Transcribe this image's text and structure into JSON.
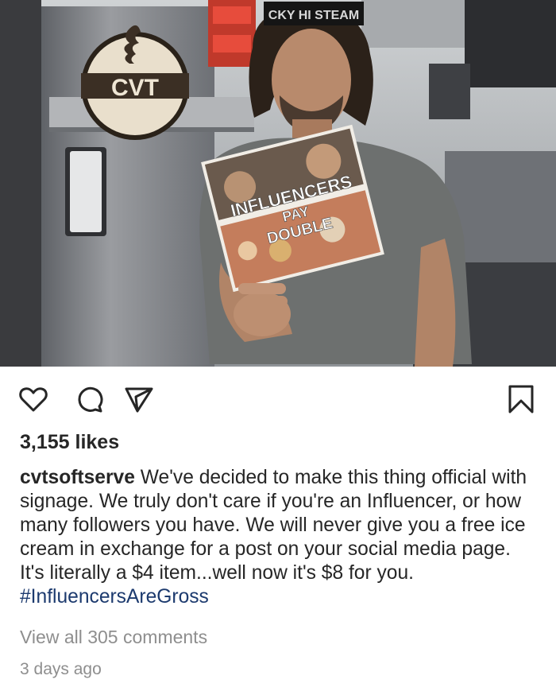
{
  "post": {
    "photo": {
      "shop_logo": "CVT",
      "headband_text": "CKY HI STEAM",
      "book_title_line1": "INFLUENCERS",
      "book_title_line2": "PAY",
      "book_title_line3": "DOUBLE"
    },
    "icons": {
      "like": "heart-icon",
      "comment": "comment-bubble-icon",
      "share": "paper-plane-icon",
      "save": "bookmark-icon"
    },
    "likes": "3,155 likes",
    "caption": {
      "username": "cvtsoftserve",
      "text": " We've decided to make this thing official with signage. We truly don't care if you're an Influencer, or how many followers you have. We will never give you a free ice cream in exchange for a post on your social media page. It's literally a $4 item...well now it's $8 for you. ",
      "hashtag": "#InfluencersAreGross"
    },
    "view_comments": "View all 305 comments",
    "timestamp": "3 days ago"
  },
  "colors": {
    "text": "#262626",
    "muted": "#8e8e8e",
    "hashtag": "#1c3a6e"
  }
}
